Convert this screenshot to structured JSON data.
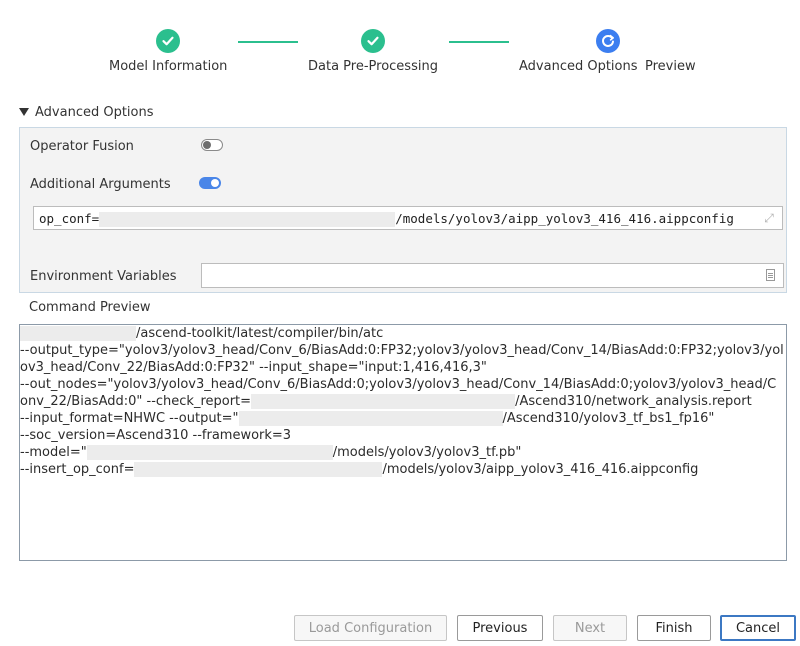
{
  "stepper": {
    "steps": [
      {
        "label": "Model Information",
        "state": "done"
      },
      {
        "label": "Data Pre-Processing",
        "state": "done"
      },
      {
        "label": "Advanced Options",
        "state": "active"
      }
    ],
    "preview_label": "Preview",
    "colors": {
      "done": "#2bbf8e",
      "active": "#3c7ef0"
    }
  },
  "advanced_options": {
    "header": "Advanced Options",
    "operator_fusion": {
      "label": "Operator Fusion",
      "enabled": false
    },
    "additional_arguments": {
      "label": "Additional Arguments",
      "enabled": true,
      "value_prefix": "op_conf=",
      "value_suffix": "/models/yolov3/aipp_yolov3_416_416.aippconfig"
    },
    "environment_variables": {
      "label": "Environment Variables",
      "value": ""
    }
  },
  "command_preview": {
    "title": "Command Preview",
    "lines": [
      {
        "prefix": "",
        "suffix": "/ascend-toolkit/latest/compiler/bin/atc",
        "redacted": true
      },
      {
        "text": "--output_type=\"yolov3/yolov3_head/Conv_6/BiasAdd:0:FP32;yolov3/yolov3_head/Conv_14/BiasAdd:0:FP32;yolov3/yol"
      },
      {
        "text": "ov3_head/Conv_22/BiasAdd:0:FP32\" --input_shape=\"input:1,416,416,3\""
      },
      {
        "text": "--out_nodes=\"yolov3/yolov3_head/Conv_6/BiasAdd:0;yolov3/yolov3_head/Conv_14/BiasAdd:0;yolov3/yolov3_head/C"
      },
      {
        "prefix": "onv_22/BiasAdd:0\" --check_report=",
        "suffix": "/Ascend310/network_analysis.report",
        "redacted": true
      },
      {
        "prefix": "--input_format=NHWC --output=\"",
        "suffix": "/Ascend310/yolov3_tf_bs1_fp16\"",
        "redacted": true
      },
      {
        "text": "--soc_version=Ascend310 --framework=3"
      },
      {
        "prefix": "--model=\"",
        "suffix": "/models/yolov3/yolov3_tf.pb\"",
        "redacted": true
      },
      {
        "prefix": "--insert_op_conf=",
        "suffix": "/models/yolov3/aipp_yolov3_416_416.aippconfig",
        "redacted": true
      }
    ]
  },
  "buttons": {
    "load_configuration": "Load Configuration",
    "previous": "Previous",
    "next": "Next",
    "finish": "Finish",
    "cancel": "Cancel"
  }
}
